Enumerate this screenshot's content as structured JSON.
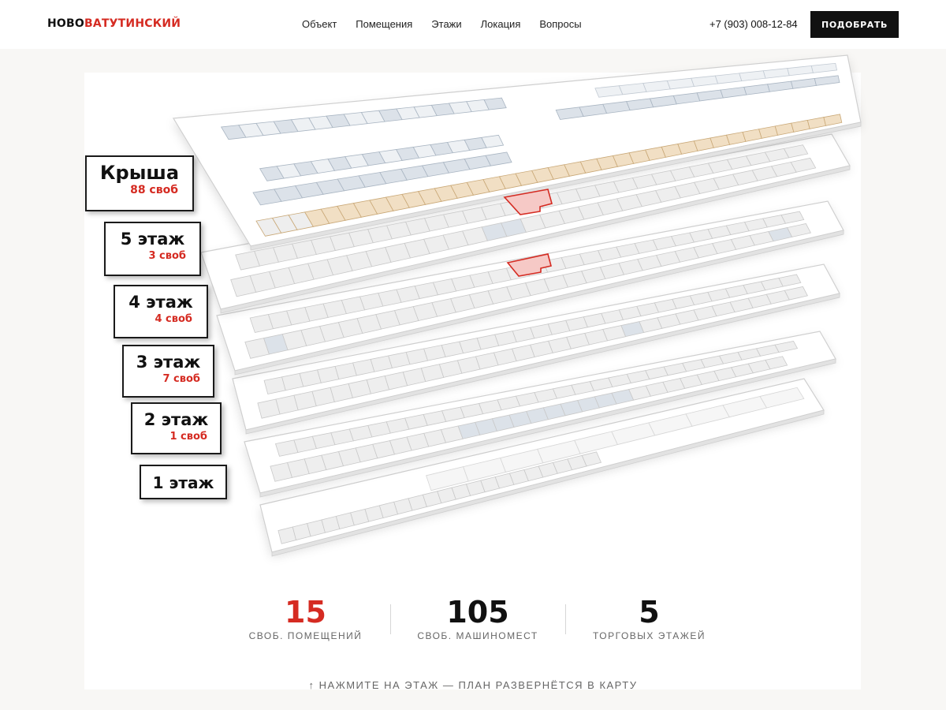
{
  "header": {
    "logo_part1": "НОВО",
    "logo_part2": "ВАТУТИНСКИЙ",
    "nav": [
      "Объект",
      "Помещения",
      "Этажи",
      "Локация",
      "Вопросы"
    ],
    "phone": "+7 (903) 008-12-84",
    "cta_label": "ПОДОБРАТЬ"
  },
  "floors": [
    {
      "name": "Крыша",
      "free": "88 своб"
    },
    {
      "name": "5 этаж",
      "free": "3 своб"
    },
    {
      "name": "4 этаж",
      "free": "4 своб"
    },
    {
      "name": "3 этаж",
      "free": "7 своб"
    },
    {
      "name": "2 этаж",
      "free": "1 своб"
    },
    {
      "name": "1 этаж",
      "free": ""
    }
  ],
  "stats": [
    {
      "value": "15",
      "label": "СВОБ. ПОМЕЩЕНИЙ"
    },
    {
      "value": "105",
      "label": "СВОБ. МАШИНОМЕСТ"
    },
    {
      "value": "5",
      "label": "ТОРГОВЫХ ЭТАЖЕЙ"
    }
  ],
  "hint": "↑ НАЖМИТЕ НА ЭТАЖ — ПЛАН РАЗВЕРНЁТСЯ В КАРТУ",
  "colors": {
    "accent": "#d52b22",
    "dark": "#111111",
    "roof_highlight": "#f1dfc4",
    "unit_free": "#dde3ea"
  }
}
